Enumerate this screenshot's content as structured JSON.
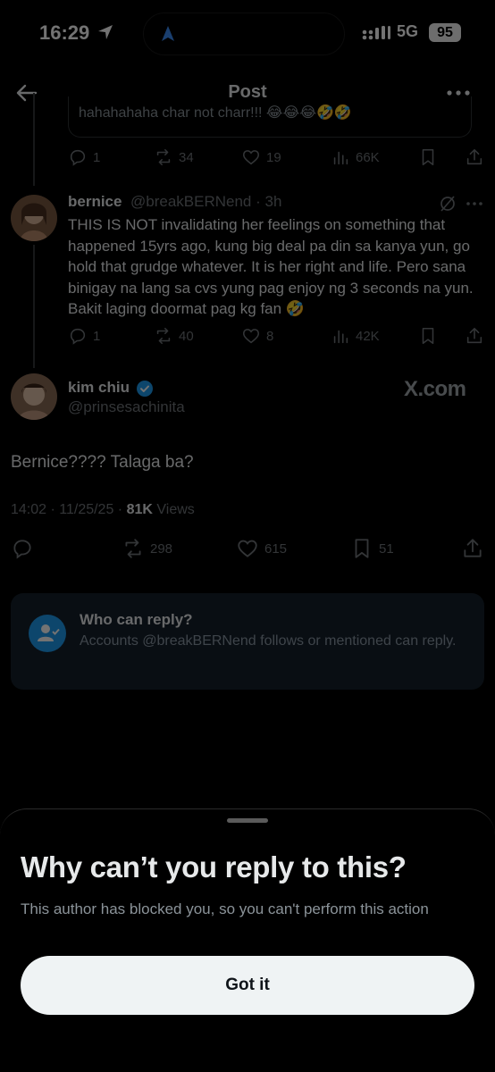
{
  "status_bar": {
    "time": "16:29",
    "network": "5G",
    "battery": "95"
  },
  "header": {
    "title": "Post"
  },
  "previous_tweet": {
    "cut_text": "hahahahaha char not charr!!! 😂😂😂🤣🤣",
    "actions": {
      "replies": "1",
      "reposts": "34",
      "likes": "19",
      "views": "66K"
    }
  },
  "reply_tweet": {
    "name": "bernice",
    "handle": "@breakBERNend",
    "time": "· 3h",
    "text": "THIS IS NOT invalidating her feelings on something that happened 15yrs ago, kung big deal pa din sa kanya yun, go hold that grudge whatever. It is her right and life. Pero sana binigay na lang sa cvs yung pag enjoy ng 3 seconds na yun. Bakit laging doormat pag kg fan 🤣",
    "actions": {
      "replies": "1",
      "reposts": "40",
      "likes": "8",
      "views": "42K"
    }
  },
  "main_tweet": {
    "name": "kim chiu",
    "handle": "@prinsesachinita",
    "watermark": "X.com",
    "text": "Bernice???? Talaga ba?",
    "timestamp": "14:02 · 11/25/25 · ",
    "views_count": "81K",
    "views_label": " Views",
    "actions": {
      "reposts": "298",
      "likes": "615",
      "bookmarks": "51"
    }
  },
  "who_can_reply": {
    "heading": "Who can reply?",
    "text": "Accounts @breakBERNend follows or mentioned can reply."
  },
  "sheet": {
    "heading": "Why can’t you reply to this?",
    "text": "This author has blocked you, so you can't perform this action",
    "button": "Got it"
  },
  "colors": {
    "accent": "#1d9bf0",
    "background": "#000000",
    "muted": "#71767b"
  }
}
